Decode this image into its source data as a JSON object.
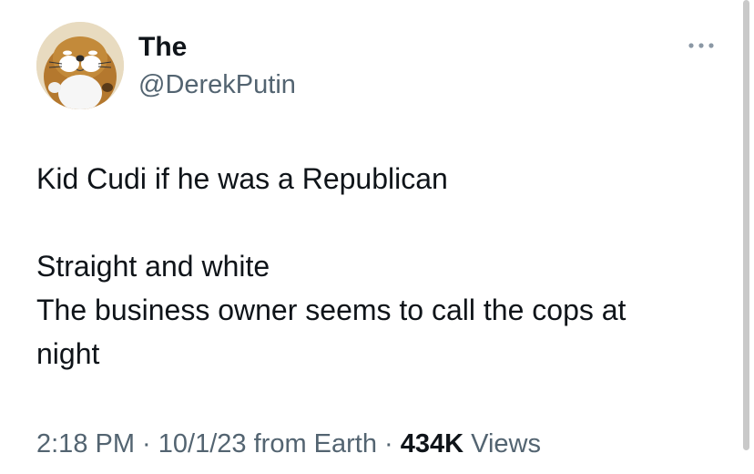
{
  "author": {
    "display_name": "The",
    "handle": "@DerekPutin",
    "avatar_icon": "cartoon-mole-avatar-icon"
  },
  "more_button": {
    "icon": "more-horizontal-icon"
  },
  "tweet": {
    "lines": [
      "Kid Cudi if he was a Republican",
      "Straight and white",
      "The business owner seems to call the cops at",
      "night"
    ]
  },
  "meta": {
    "time": "2:18 PM",
    "sep1": " · ",
    "date": "10/1/23",
    "source": " from Earth",
    "sep2": " · ",
    "views_count": "434K",
    "views_label": " Views"
  },
  "colors": {
    "text_primary": "#0f1419",
    "text_secondary": "#536471",
    "background": "#ffffff"
  }
}
